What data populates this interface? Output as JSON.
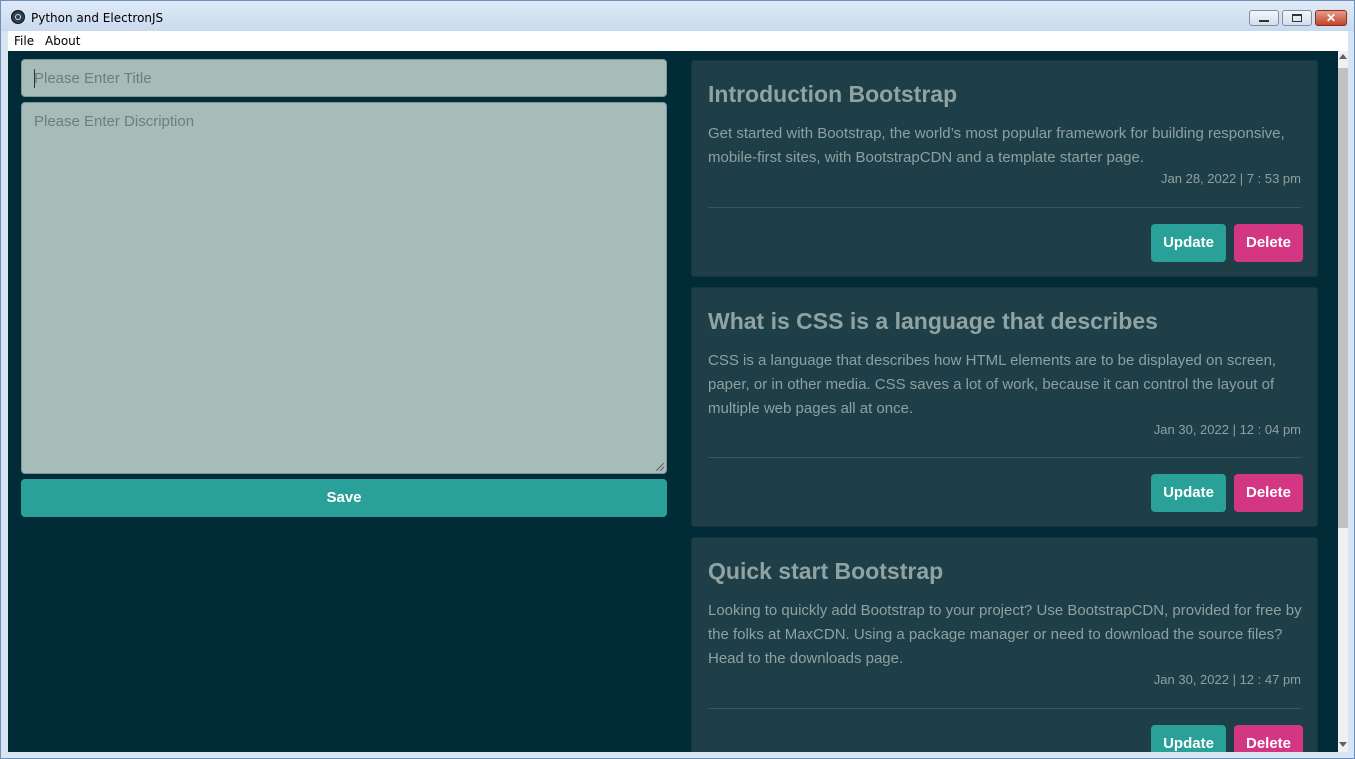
{
  "window": {
    "title": "Python and ElectronJS",
    "close_glyph": "✕"
  },
  "menu": {
    "items": [
      "File",
      "About"
    ]
  },
  "form": {
    "title_placeholder": "Please Enter Title",
    "description_placeholder": "Please Enter Discription",
    "save_label": "Save"
  },
  "notes": [
    {
      "title": "Introduction Bootstrap",
      "text": "Get started with Bootstrap, the world’s most popular framework for building responsive, mobile-first sites, with BootstrapCDN and a template starter page.",
      "date": "Jan 28, 2022 | 7 : 53 pm",
      "update_label": "Update",
      "delete_label": "Delete"
    },
    {
      "title": "What is CSS is a language that describes",
      "text": "CSS is a language that describes how HTML elements are to be displayed on screen, paper, or in other media. CSS saves a lot of work, because it can control the layout of multiple web pages all at once.",
      "date": "Jan 30, 2022 | 12 : 04 pm",
      "update_label": "Update",
      "delete_label": "Delete"
    },
    {
      "title": "Quick start Bootstrap",
      "text": "Looking to quickly add Bootstrap to your project? Use BootstrapCDN, provided for free by the folks at MaxCDN. Using a package manager or need to download the source files? Head to the downloads page.",
      "date": "Jan 30, 2022 | 12 : 47 pm",
      "update_label": "Update",
      "delete_label": "Delete"
    }
  ],
  "colors": {
    "background": "#012b36",
    "card": "#1e3f48",
    "input": "#a7bbb9",
    "primary": "#2aa198",
    "danger": "#d33682"
  }
}
